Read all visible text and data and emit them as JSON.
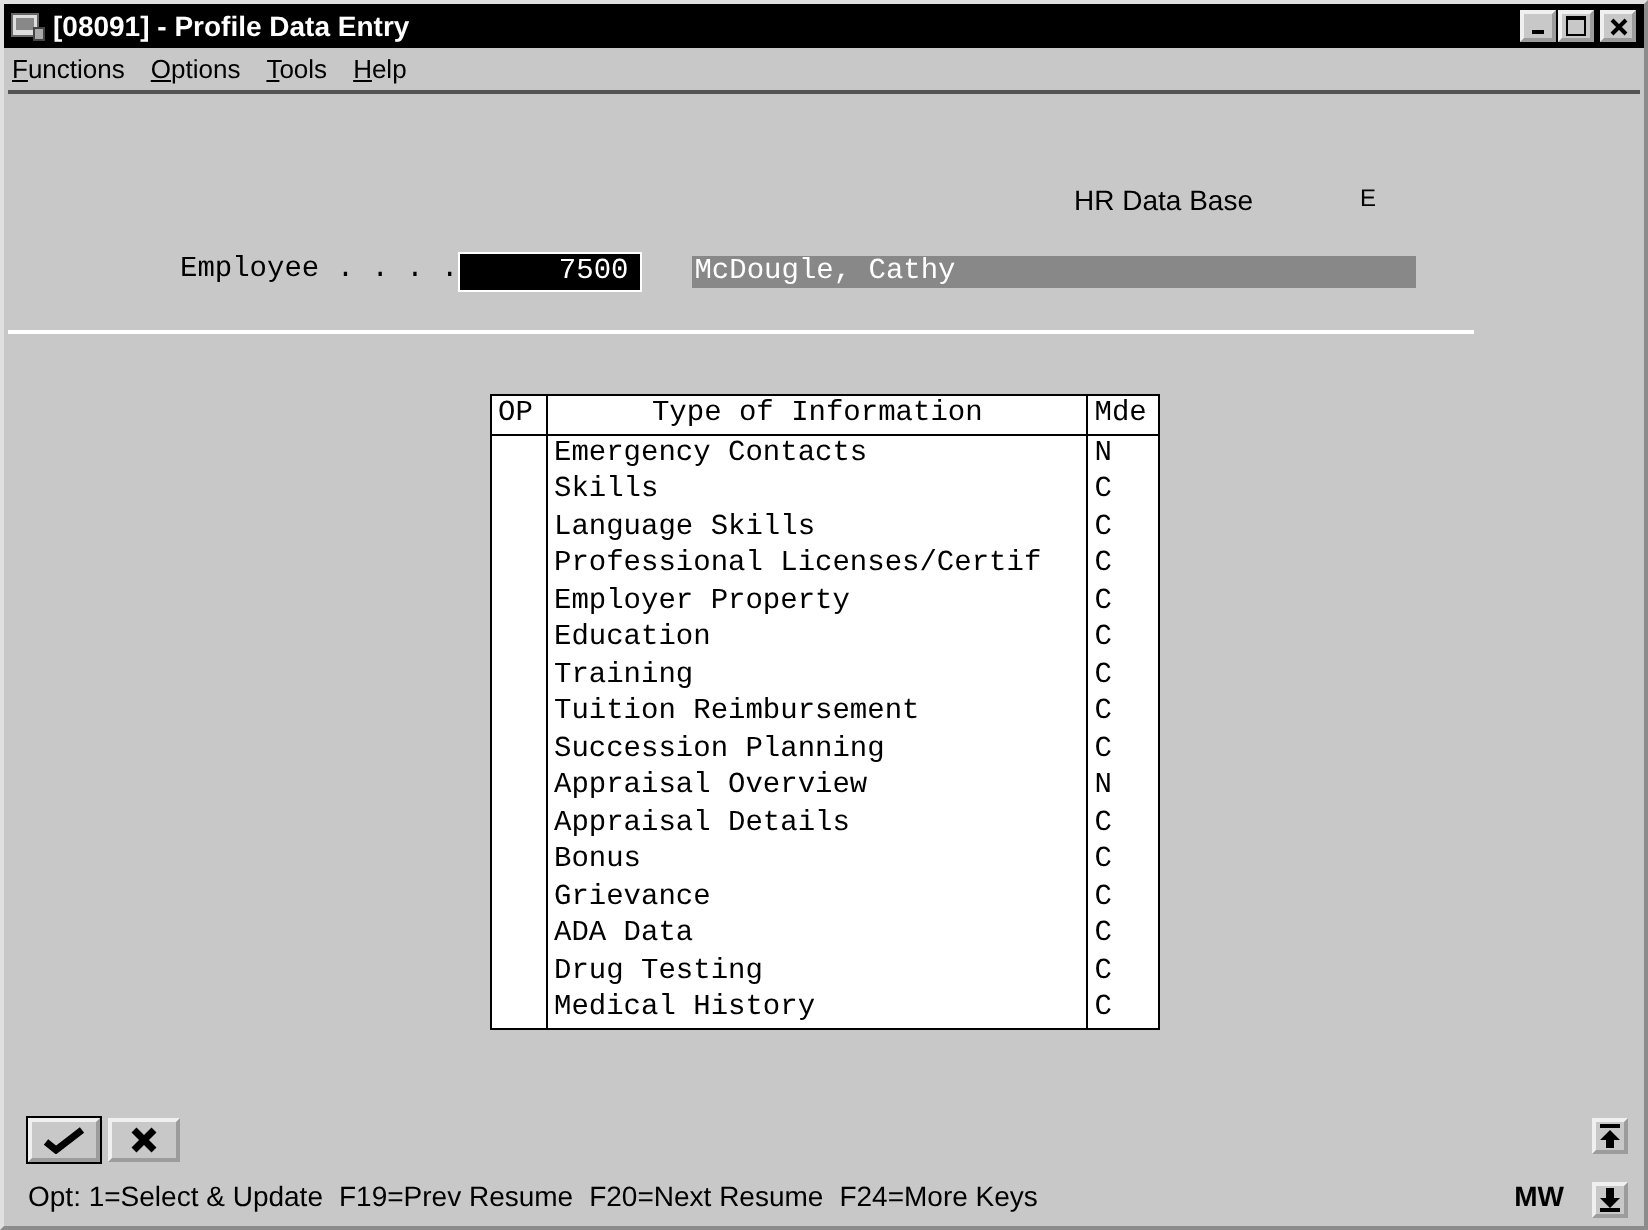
{
  "window": {
    "title": "[08091] - Profile Data Entry"
  },
  "menu": [
    "Functions",
    "Options",
    "Tools",
    "Help"
  ],
  "header": {
    "database": "HR Data Base",
    "code": "E"
  },
  "employee": {
    "label": "Employee . . . .",
    "value": "7500",
    "name": "McDougle, Cathy"
  },
  "table": {
    "columns": [
      "OP",
      "Type of Information",
      "Mde"
    ],
    "rows": [
      {
        "type": "Emergency Contacts",
        "mode": "N"
      },
      {
        "type": "Skills",
        "mode": "C"
      },
      {
        "type": "Language Skills",
        "mode": "C"
      },
      {
        "type": "Professional Licenses/Certif",
        "mode": "C"
      },
      {
        "type": "Employer Property",
        "mode": "C"
      },
      {
        "type": "Education",
        "mode": "C"
      },
      {
        "type": "Training",
        "mode": "C"
      },
      {
        "type": "Tuition Reimbursement",
        "mode": "C"
      },
      {
        "type": "Succession Planning",
        "mode": "C"
      },
      {
        "type": "Appraisal Overview",
        "mode": "N"
      },
      {
        "type": "Appraisal Details",
        "mode": "C"
      },
      {
        "type": "Bonus",
        "mode": "C"
      },
      {
        "type": "Grievance",
        "mode": "C"
      },
      {
        "type": "ADA Data",
        "mode": "C"
      },
      {
        "type": "Drug Testing",
        "mode": "C"
      },
      {
        "type": "Medical History",
        "mode": "C"
      }
    ]
  },
  "status_bar": {
    "hints": [
      "Opt: 1=Select & Update",
      "F19=Prev Resume",
      "F20=Next Resume",
      "F24=More Keys"
    ],
    "mode": "MW"
  }
}
